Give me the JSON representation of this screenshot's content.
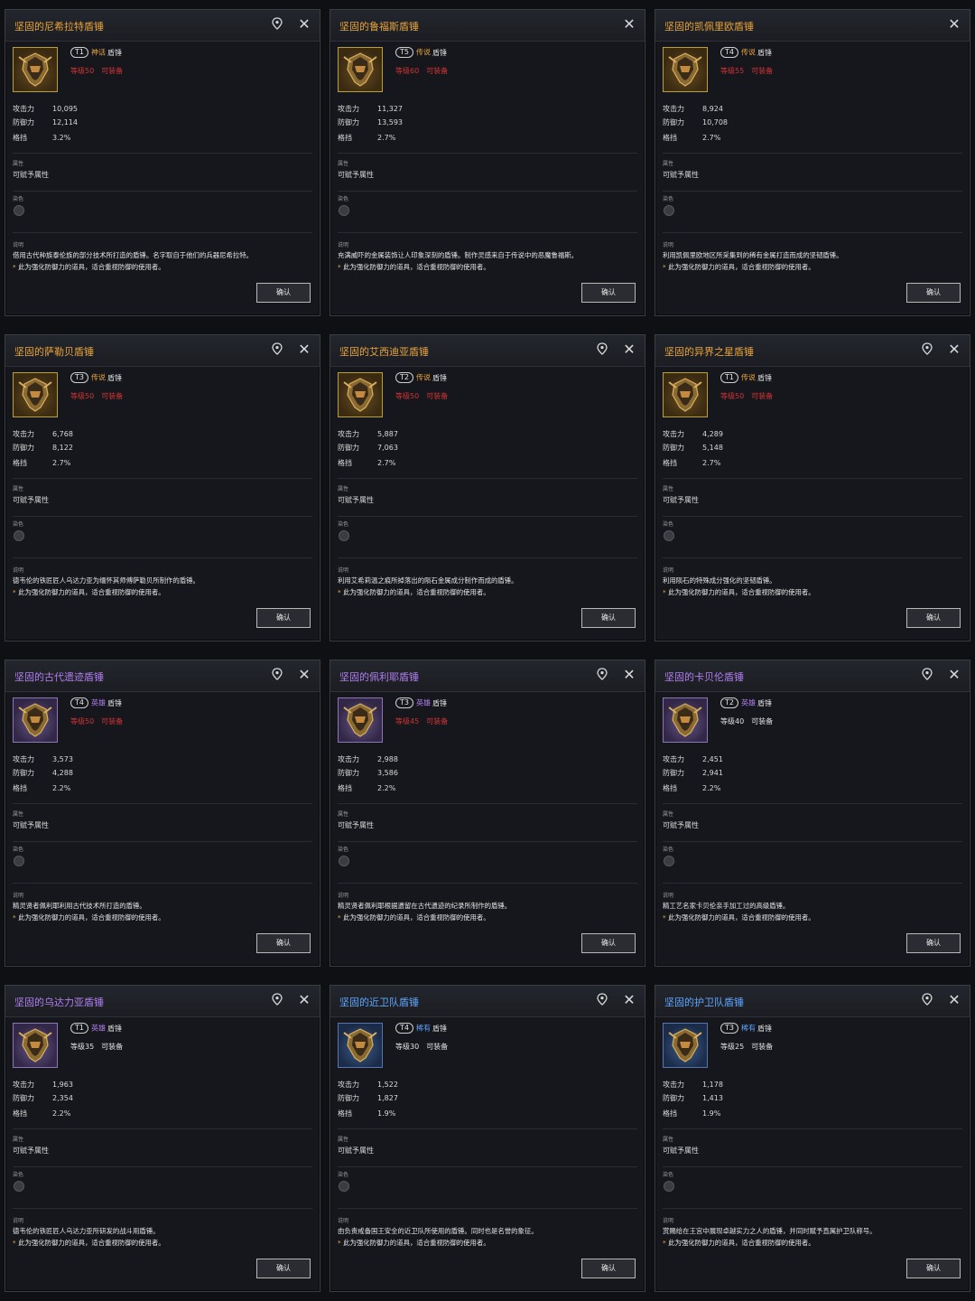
{
  "labels": {
    "attack": "攻击力",
    "defense": "防御力",
    "block": "格挡",
    "attribute_section": "属性",
    "attribute_value": "可赋予属性",
    "dye_section": "染色",
    "description_section": "说明",
    "kind": "盾锤",
    "equippable": "可装备",
    "confirm": "确认",
    "note": "此为强化防御力的道具，适合重视防御的使用者。"
  },
  "icons": {
    "pin": "location-pin-icon",
    "close": "close-x-icon",
    "item": "shield-hammer-icon",
    "dye": "dye-slot-icon"
  },
  "colors": {
    "legendary": "#e8a43c",
    "heroic": "#b17ff0",
    "rare": "#5fa6ff",
    "level_unmet": "#d23434"
  },
  "cards": [
    {
      "name": "坚固的尼希拉特盾锤",
      "tier": "T1",
      "grade": "神话",
      "grade_class": "legend",
      "level": "等级50",
      "level_met": false,
      "attack": "10,095",
      "defense": "12,114",
      "block": "3.2%",
      "description": "借用古代种族泰伦族的部分技术所打造的盾锤。名字取自于他们的兵器尼希拉特。",
      "has_pin": true
    },
    {
      "name": "坚固的鲁福斯盾锤",
      "tier": "T5",
      "grade": "传说",
      "grade_class": "legend",
      "level": "等级60",
      "level_met": false,
      "attack": "11,327",
      "defense": "13,593",
      "block": "2.7%",
      "description": "充满威吓的金属装饰让人印象深刻的盾锤。制作灵感来自于传说中的恶魔鲁福斯。",
      "has_pin": false
    },
    {
      "name": "坚固的凯佩里欧盾锤",
      "tier": "T4",
      "grade": "传说",
      "grade_class": "legend",
      "level": "等级55",
      "level_met": false,
      "attack": "8,924",
      "defense": "10,708",
      "block": "2.7%",
      "description": "利用凯佩里欧地区所采集到的稀有金属打造而成的坚韧盾锤。",
      "has_pin": false
    },
    {
      "name": "坚固的萨勒贝盾锤",
      "tier": "T3",
      "grade": "传说",
      "grade_class": "legend",
      "level": "等级50",
      "level_met": false,
      "attack": "6,768",
      "defense": "8,122",
      "block": "2.7%",
      "description": "德韦伦的铁匠匠人乌达力亚为缅怀其师傅萨勒贝所制作的盾锤。",
      "has_pin": true
    },
    {
      "name": "坚固的艾西迪亚盾锤",
      "tier": "T2",
      "grade": "传说",
      "grade_class": "legend",
      "level": "等级50",
      "level_met": false,
      "attack": "5,887",
      "defense": "7,063",
      "block": "2.7%",
      "description": "利用艾希莉温之痕所掉落出的陨石金属成分制作而成的盾锤。",
      "has_pin": true
    },
    {
      "name": "坚固的异界之星盾锤",
      "tier": "T1",
      "grade": "传说",
      "grade_class": "legend",
      "level": "等级50",
      "level_met": false,
      "attack": "4,289",
      "defense": "5,148",
      "block": "2.7%",
      "description": "利用陨石的特殊成分强化的坚韧盾锤。",
      "has_pin": true
    },
    {
      "name": "坚固的古代遗迹盾锤",
      "tier": "T4",
      "grade": "英雄",
      "grade_class": "hero",
      "level": "等级50",
      "level_met": false,
      "attack": "3,573",
      "defense": "4,288",
      "block": "2.2%",
      "description": "精灵贤者佩利耶利用古代技术所打造的盾锤。",
      "has_pin": true
    },
    {
      "name": "坚固的佩利耶盾锤",
      "tier": "T3",
      "grade": "英雄",
      "grade_class": "hero",
      "level": "等级45",
      "level_met": false,
      "attack": "2,988",
      "defense": "3,586",
      "block": "2.2%",
      "description": "精灵贤者佩利耶根据遗留在古代遗迹的纪录所制作的盾锤。",
      "has_pin": true
    },
    {
      "name": "坚固的卡贝伦盾锤",
      "tier": "T2",
      "grade": "英雄",
      "grade_class": "hero",
      "level": "等级40",
      "level_met": true,
      "attack": "2,451",
      "defense": "2,941",
      "block": "2.2%",
      "description": "精工艺名家卡贝伦亲手加工过的高级盾锤。",
      "has_pin": true
    },
    {
      "name": "坚固的乌达力亚盾锤",
      "tier": "T1",
      "grade": "英雄",
      "grade_class": "hero",
      "level": "等级35",
      "level_met": true,
      "attack": "1,963",
      "defense": "2,354",
      "block": "2.2%",
      "description": "德韦伦的铁匠匠人乌达力亚所研发的战斗用盾锤。",
      "has_pin": true
    },
    {
      "name": "坚固的近卫队盾锤",
      "tier": "T4",
      "grade": "稀有",
      "grade_class": "rare",
      "level": "等级30",
      "level_met": true,
      "attack": "1,522",
      "defense": "1,827",
      "block": "1.9%",
      "description": "由负责戒备国王安全的近卫队所使用的盾锤。同时也是名誉的象征。",
      "has_pin": true
    },
    {
      "name": "坚固的护卫队盾锤",
      "tier": "T3",
      "grade": "稀有",
      "grade_class": "rare",
      "level": "等级25",
      "level_met": true,
      "attack": "1,178",
      "defense": "1,413",
      "block": "1.9%",
      "description": "赏赐给在王宫中展现卓越实力之人的盾锤，并同时赋予直属护卫队称号。",
      "has_pin": true
    }
  ]
}
